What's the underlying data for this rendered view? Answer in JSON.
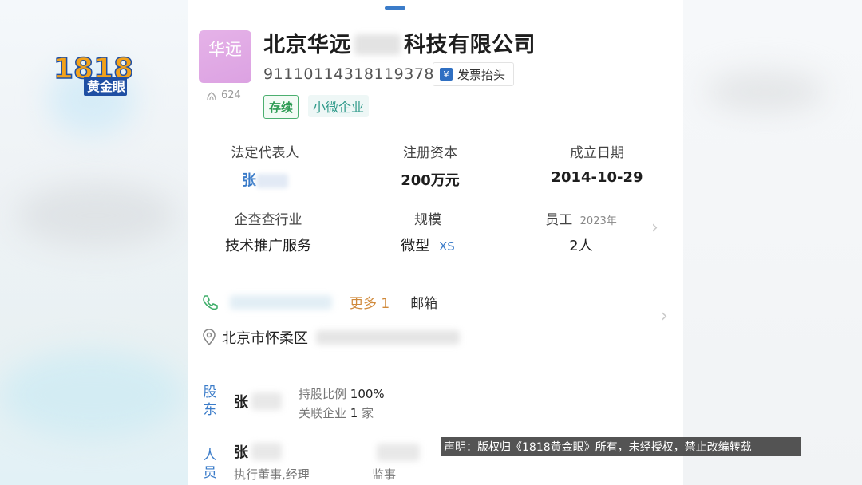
{
  "company": {
    "logo_text": "华远",
    "name_prefix": "北京华远",
    "name_suffix": "科技有限公司",
    "credit_code": "91110114318119378Y",
    "invoice_label": "发票抬头",
    "invoice_icon_glyph": "¥",
    "views": "624",
    "status": "存续",
    "scale_tag": "小微企业"
  },
  "info": {
    "legal_rep": {
      "label": "法定代表人",
      "value": "张"
    },
    "capital": {
      "label": "注册资本",
      "value": "200万元"
    },
    "founded": {
      "label": "成立日期",
      "value": "2014-10-29"
    },
    "industry": {
      "label": "企查查行业",
      "value": "技术推广服务"
    },
    "size": {
      "label": "规模",
      "value": "微型",
      "tag": "XS"
    },
    "staff": {
      "label": "员工",
      "year": "2023年",
      "value": "2人"
    }
  },
  "contact": {
    "more_label": "更多 1",
    "email_label": "邮箱",
    "address_prefix": "北京市怀柔区"
  },
  "shareholder": {
    "section_label_1": "股",
    "section_label_2": "东",
    "name": "张",
    "ratio_label": "持股比例",
    "ratio_value": "100%",
    "related_label": "关联企业",
    "related_value": "1",
    "related_unit": "家"
  },
  "personnel": {
    "section_label_1": "人",
    "section_label_2": "员",
    "person1_name": "张",
    "person1_role": "执行董事,经理",
    "person2_role": "监事"
  },
  "watermark": {
    "logo_number": "1818",
    "logo_text": "黄金眼",
    "disclaimer": "声明：版权归《1818黄金眼》所有，未经授权，禁止改编转载"
  },
  "colors": {
    "accent_blue": "#3b7cc9",
    "status_green": "#2f9c55",
    "more_orange": "#d0893a",
    "logo_pink": "#dca2e2"
  }
}
